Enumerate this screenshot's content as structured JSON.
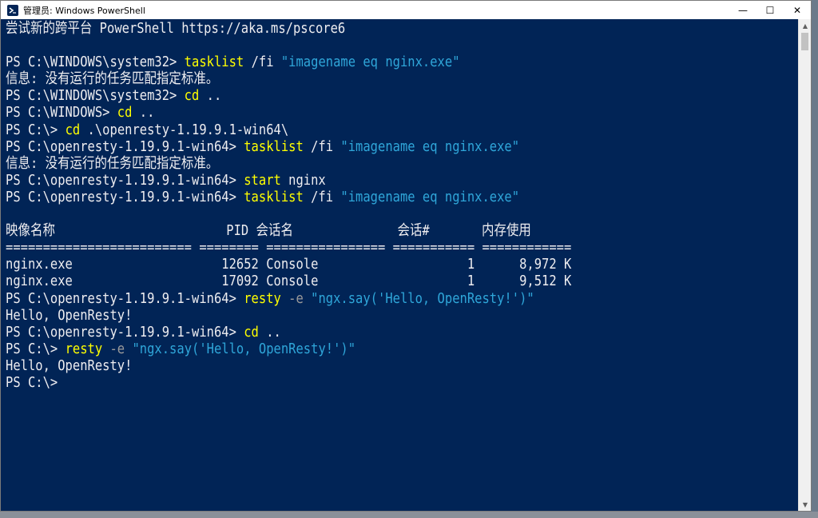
{
  "window": {
    "title": "管理员: Windows PowerShell",
    "minimize_glyph": "—",
    "maximize_glyph": "☐",
    "close_glyph": "✕"
  },
  "colors": {
    "console_bg": "#012456",
    "text": "#eeedf0",
    "command": "#ffff00",
    "string": "#2fa6d9",
    "parameter": "#9a9a9a"
  },
  "console": {
    "lines": [
      {
        "segments": [
          {
            "t": "尝试新的跨平台 PowerShell https://aka.ms/pscore6",
            "c": "text"
          }
        ]
      },
      {
        "segments": []
      },
      {
        "segments": [
          {
            "t": "PS C:\\WINDOWS\\system32> ",
            "c": "text"
          },
          {
            "t": "tasklist",
            "c": "cmd"
          },
          {
            "t": " /fi ",
            "c": "text"
          },
          {
            "t": "\"imagename eq nginx.exe\"",
            "c": "str"
          }
        ]
      },
      {
        "segments": [
          {
            "t": "信息: 没有运行的任务匹配指定标准。",
            "c": "text"
          }
        ]
      },
      {
        "segments": [
          {
            "t": "PS C:\\WINDOWS\\system32> ",
            "c": "text"
          },
          {
            "t": "cd",
            "c": "cmd"
          },
          {
            "t": " ..",
            "c": "text"
          }
        ]
      },
      {
        "segments": [
          {
            "t": "PS C:\\WINDOWS> ",
            "c": "text"
          },
          {
            "t": "cd",
            "c": "cmd"
          },
          {
            "t": " ..",
            "c": "text"
          }
        ]
      },
      {
        "segments": [
          {
            "t": "PS C:\\> ",
            "c": "text"
          },
          {
            "t": "cd",
            "c": "cmd"
          },
          {
            "t": " .\\openresty-1.19.9.1-win64\\",
            "c": "text"
          }
        ]
      },
      {
        "segments": [
          {
            "t": "PS C:\\openresty-1.19.9.1-win64> ",
            "c": "text"
          },
          {
            "t": "tasklist",
            "c": "cmd"
          },
          {
            "t": " /fi ",
            "c": "text"
          },
          {
            "t": "\"imagename eq nginx.exe\"",
            "c": "str"
          }
        ]
      },
      {
        "segments": [
          {
            "t": "信息: 没有运行的任务匹配指定标准。",
            "c": "text"
          }
        ]
      },
      {
        "segments": [
          {
            "t": "PS C:\\openresty-1.19.9.1-win64> ",
            "c": "text"
          },
          {
            "t": "start",
            "c": "cmd"
          },
          {
            "t": " nginx",
            "c": "text"
          }
        ]
      },
      {
        "segments": [
          {
            "t": "PS C:\\openresty-1.19.9.1-win64> ",
            "c": "text"
          },
          {
            "t": "tasklist",
            "c": "cmd"
          },
          {
            "t": " /fi ",
            "c": "text"
          },
          {
            "t": "\"imagename eq nginx.exe\"",
            "c": "str"
          }
        ]
      },
      {
        "segments": []
      },
      {
        "segments": [
          {
            "t": "映像名称                       PID 会话名              会话#       内存使用",
            "c": "text"
          }
        ]
      },
      {
        "segments": [
          {
            "t": "========================= ======== ================ =========== ============",
            "c": "text"
          }
        ]
      },
      {
        "segments": [
          {
            "t": "nginx.exe                    12652 Console                    1      8,972 K",
            "c": "text"
          }
        ]
      },
      {
        "segments": [
          {
            "t": "nginx.exe                    17092 Console                    1      9,512 K",
            "c": "text"
          }
        ]
      },
      {
        "segments": [
          {
            "t": "PS C:\\openresty-1.19.9.1-win64> ",
            "c": "text"
          },
          {
            "t": "resty",
            "c": "cmd"
          },
          {
            "t": " -e ",
            "c": "param"
          },
          {
            "t": "\"ngx.say('Hello, OpenResty!')\"",
            "c": "str"
          }
        ]
      },
      {
        "segments": [
          {
            "t": "Hello, OpenResty!",
            "c": "text"
          }
        ]
      },
      {
        "segments": [
          {
            "t": "PS C:\\openresty-1.19.9.1-win64> ",
            "c": "text"
          },
          {
            "t": "cd",
            "c": "cmd"
          },
          {
            "t": " ..",
            "c": "text"
          }
        ]
      },
      {
        "segments": [
          {
            "t": "PS C:\\> ",
            "c": "text"
          },
          {
            "t": "resty",
            "c": "cmd"
          },
          {
            "t": " -e ",
            "c": "param"
          },
          {
            "t": "\"ngx.say('Hello, OpenResty!')\"",
            "c": "str"
          }
        ]
      },
      {
        "segments": [
          {
            "t": "Hello, OpenResty!",
            "c": "text"
          }
        ]
      },
      {
        "segments": [
          {
            "t": "PS C:\\> ",
            "c": "text"
          }
        ]
      }
    ]
  },
  "scrollbar": {
    "up_glyph": "▲",
    "down_glyph": "▼"
  }
}
